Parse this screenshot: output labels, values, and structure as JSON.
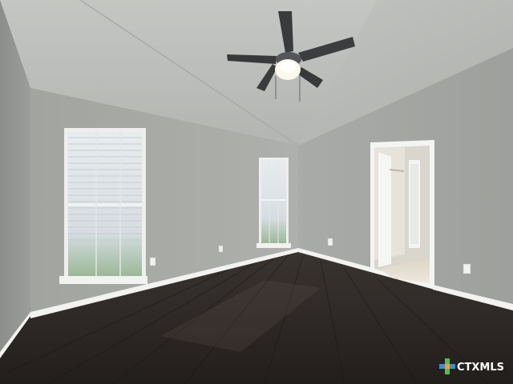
{
  "watermark": {
    "brand_text": "CTXMLS",
    "brand_icon": "ctxmls-logo-icon",
    "color_text": "#ffffff",
    "color_accent_green": "#5cb85c",
    "color_accent_blue": "#3a8fd6",
    "color_accent_orange": "#f0a030"
  },
  "scene": {
    "wall_color": "#a8aaa7",
    "ceiling_color": "#bcbebb",
    "floor_color": "#2c2724",
    "trim_color": "#f2f2f0"
  }
}
